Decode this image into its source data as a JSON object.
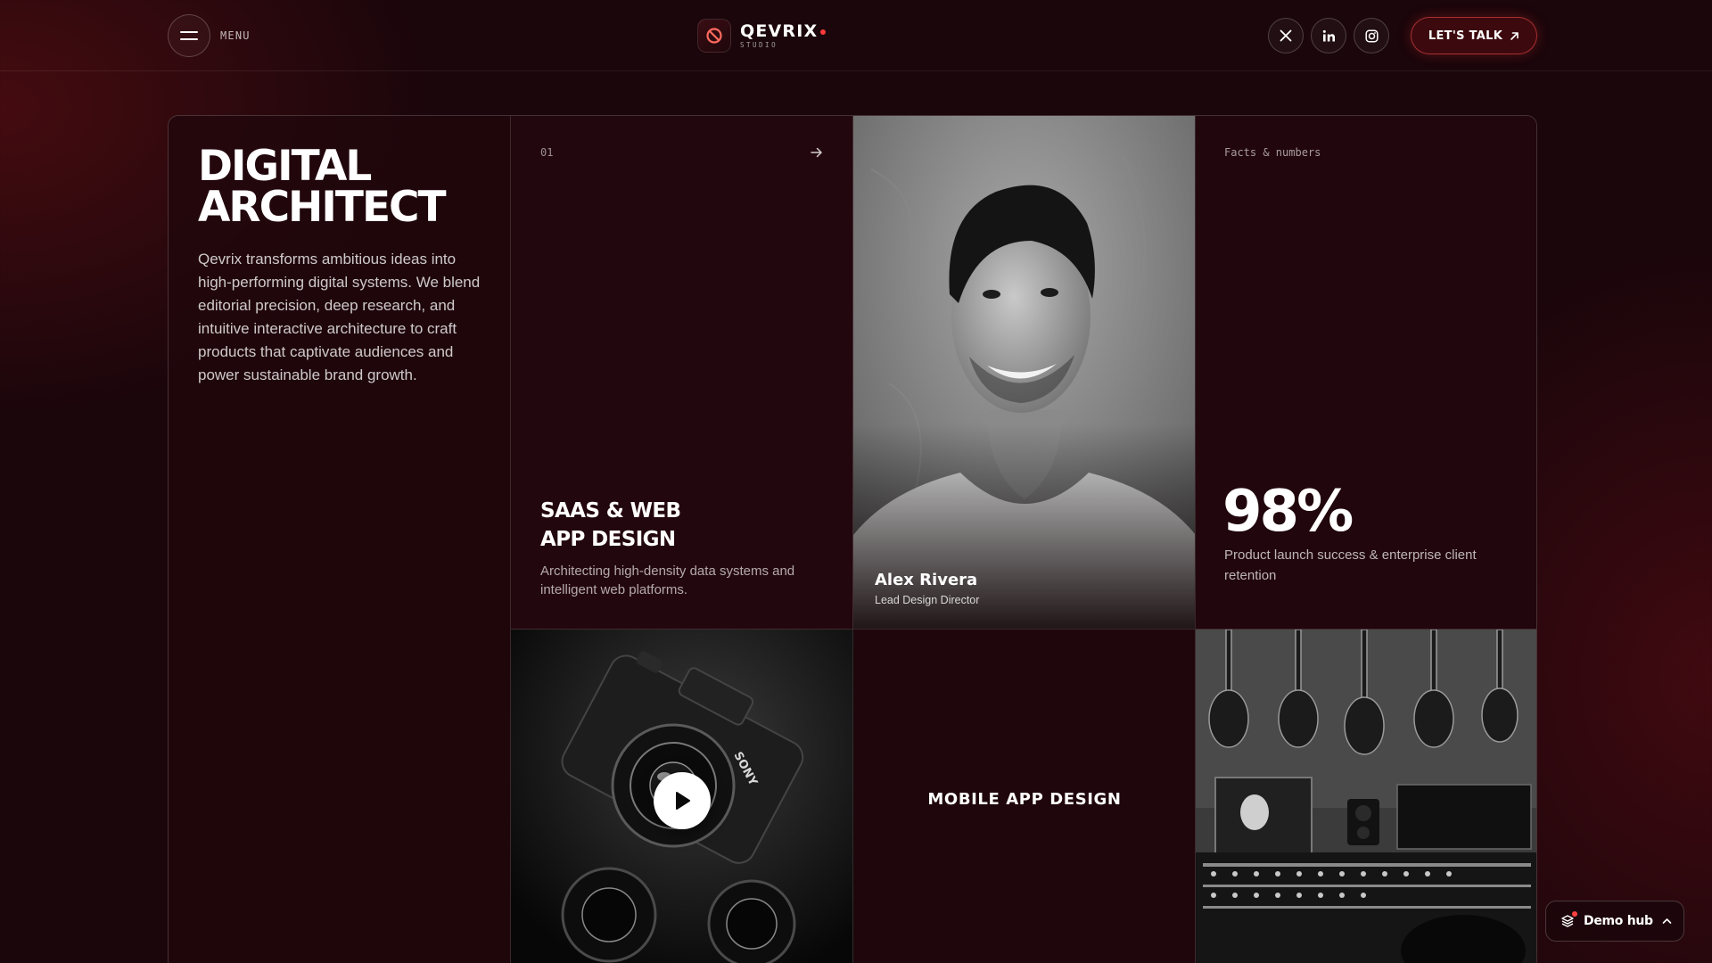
{
  "header": {
    "menu_label": "MENU",
    "brand_name": "QEVRIX",
    "brand_sub": "STUDIO",
    "social": [
      "x-icon",
      "linkedin-icon",
      "instagram-icon"
    ],
    "cta_label": "LET'S TALK"
  },
  "intro": {
    "title_line1": "DIGITAL",
    "title_line2": "ARCHITECT",
    "text": "Qevrix transforms ambitious ideas into high-performing digital systems. We blend editorial precision, deep research, and intuitive interactive architecture to craft products that captivate audiences and power sustainable brand growth."
  },
  "service": {
    "number": "01",
    "title_line1": "SAAS & WEB",
    "title_line2": "APP DESIGN",
    "description": "Architecting high-density data systems and intelligent web platforms."
  },
  "person": {
    "name": "Alex Rivera",
    "role": "Lead Design Director"
  },
  "facts": {
    "label": "Facts & numbers",
    "value": "98%",
    "description": "Product launch success & enterprise client retention"
  },
  "media": {
    "camera_brand": "SONY"
  },
  "mobile": {
    "title": "MOBILE APP DESIGN"
  },
  "demo_hub": {
    "label": "Demo hub"
  },
  "colors": {
    "background": "#1a060b",
    "accent": "#ff3b3b",
    "card": "#23070e"
  }
}
